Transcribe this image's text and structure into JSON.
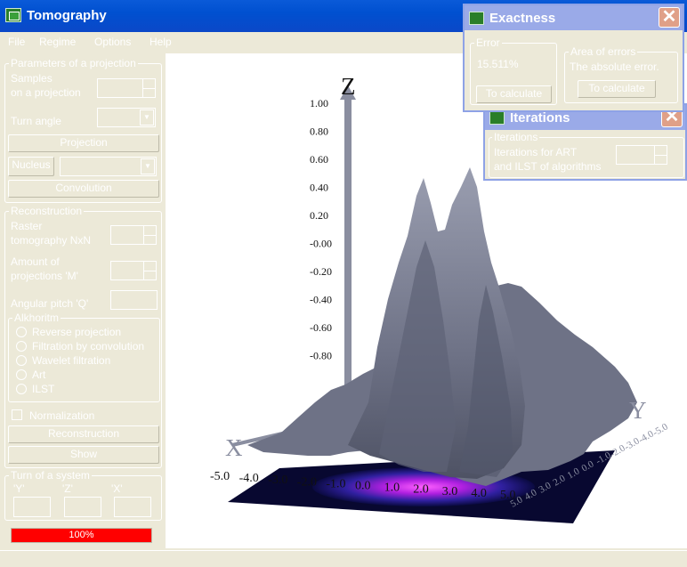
{
  "window": {
    "title": "Tomography",
    "icon": "table-icon"
  },
  "menu": [
    "File",
    "Regime",
    "Options",
    "Help"
  ],
  "projection": {
    "group_label": "Parameters of a projection",
    "samples_label_1": "Samples",
    "samples_label_2": "on a projection",
    "turn_angle_label": "Turn angle",
    "projection_button": "Projection",
    "nucleus_button": "Nucleus",
    "convolution_button": "Convolution"
  },
  "reconstruction": {
    "group_label": "Reconstruction",
    "raster_label_1": "Raster",
    "raster_label_2": "tomography NxN",
    "amount_label_1": "Amount of",
    "amount_label_2": "projections 'M'",
    "angular_label": "Angular pitch 'Q'",
    "algorithm_label": "Alkhoritm",
    "algorithms": [
      "Reverse projection",
      "Filtration by convolution",
      "Wavelet filtration",
      "Art",
      "ILST"
    ],
    "normalization_label": "Normalization",
    "reconstruction_button": "Reconstruction",
    "show_button": "Show"
  },
  "turn": {
    "group_label": "Turn of a system",
    "labels": [
      "'Y'",
      "'Z'",
      "'X'"
    ]
  },
  "progress": {
    "value": 1.0,
    "text": "100%"
  },
  "plot": {
    "z_axis_name": "Z",
    "x_axis_name": "X",
    "y_axis_name": "Y",
    "z_ticks": [
      "1.00",
      "0.80",
      "0.60",
      "0.40",
      "0.20",
      "-0.00",
      "-0.20",
      "-0.40",
      "-0.60",
      "-0.80"
    ],
    "x_ticks": [
      "-5.0",
      "-4.0",
      "-3.0",
      "-2.0",
      "-1.0",
      "0.0",
      "1.0",
      "2.0",
      "3.0",
      "4.0",
      "5.0"
    ],
    "y_ticks": [
      "5.0",
      "4.0",
      "3.0",
      "2.0",
      "1.0",
      "0.0",
      "-1.0",
      "-2.0",
      "-3.0",
      "-4.0",
      "-5.0"
    ],
    "surface_color": "#7a7e90",
    "projection_glow": "#ff40ff"
  },
  "exactness": {
    "title": "Exactness",
    "error_group": "Error",
    "error_value": "15.511%",
    "calc_button_1": "To calculate",
    "area_group": "Area of errors",
    "area_text": "The absolute error.",
    "calc_button_2": "To calculate"
  },
  "iterations": {
    "title": "Iterations",
    "group_label": "Iterations",
    "label_1": "Iterations for ART",
    "label_2": "and ILST of algorithms"
  },
  "colors": {
    "title_blue": "#0a5ad8",
    "inactive_title": "#9aaae8",
    "progress_red": "#ff0000"
  }
}
